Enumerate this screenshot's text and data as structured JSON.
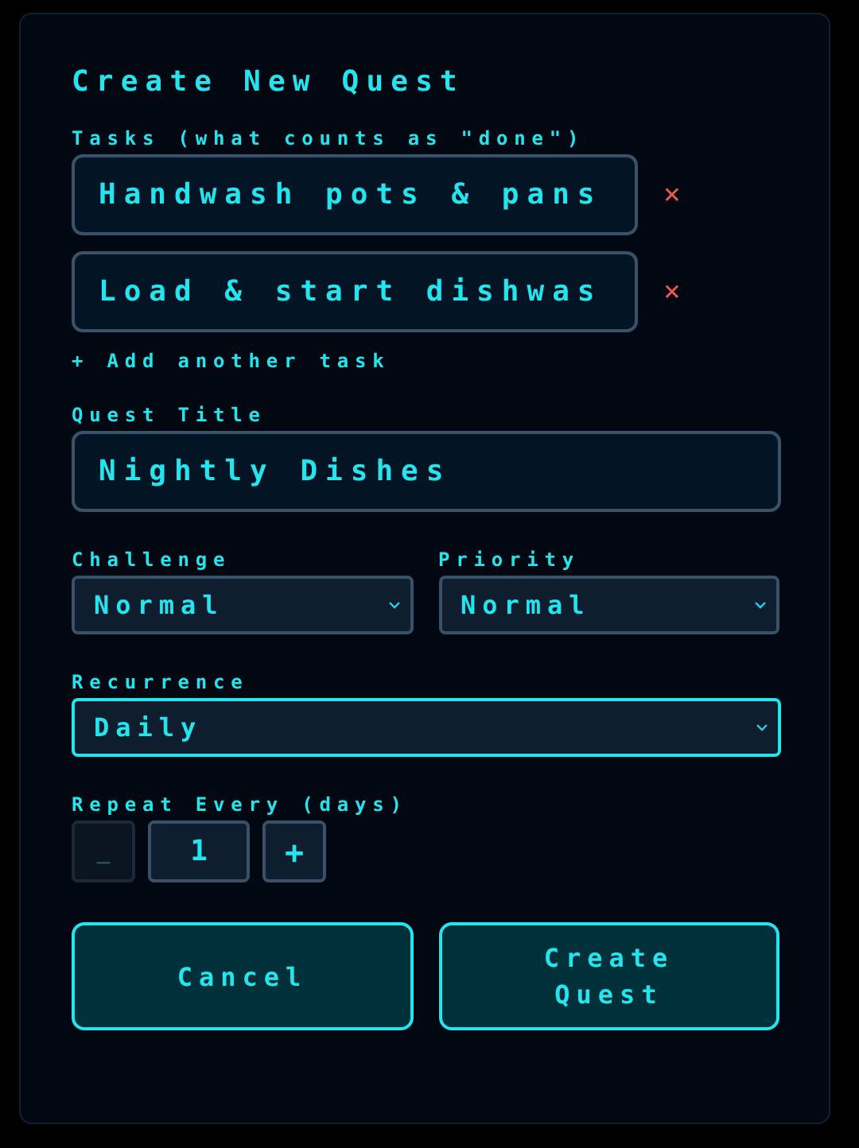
{
  "dialog": {
    "title": "Create New Quest",
    "tasks_label": "Tasks (what counts as \"done\")",
    "tasks": [
      {
        "value": "Handwash pots & pans",
        "remove": "×"
      },
      {
        "value": "Load & start dishwas",
        "remove": "×"
      }
    ],
    "add_task": "+ Add another task",
    "title_label": "Quest Title",
    "title_value": "Nightly Dishes",
    "selects": [
      {
        "label": "Challenge",
        "value": "Normal",
        "focused": false
      },
      {
        "label": "Priority",
        "value": "Normal",
        "focused": false
      }
    ],
    "recurrence": {
      "label": "Recurrence",
      "value": "Daily",
      "focused": true
    },
    "repeat": {
      "label": "Repeat Every (days)",
      "minus": "_",
      "minus_disabled": true,
      "value": "1",
      "plus": "+"
    },
    "buttons": [
      {
        "label": "Cancel"
      },
      {
        "label": "Create Quest"
      }
    ]
  }
}
